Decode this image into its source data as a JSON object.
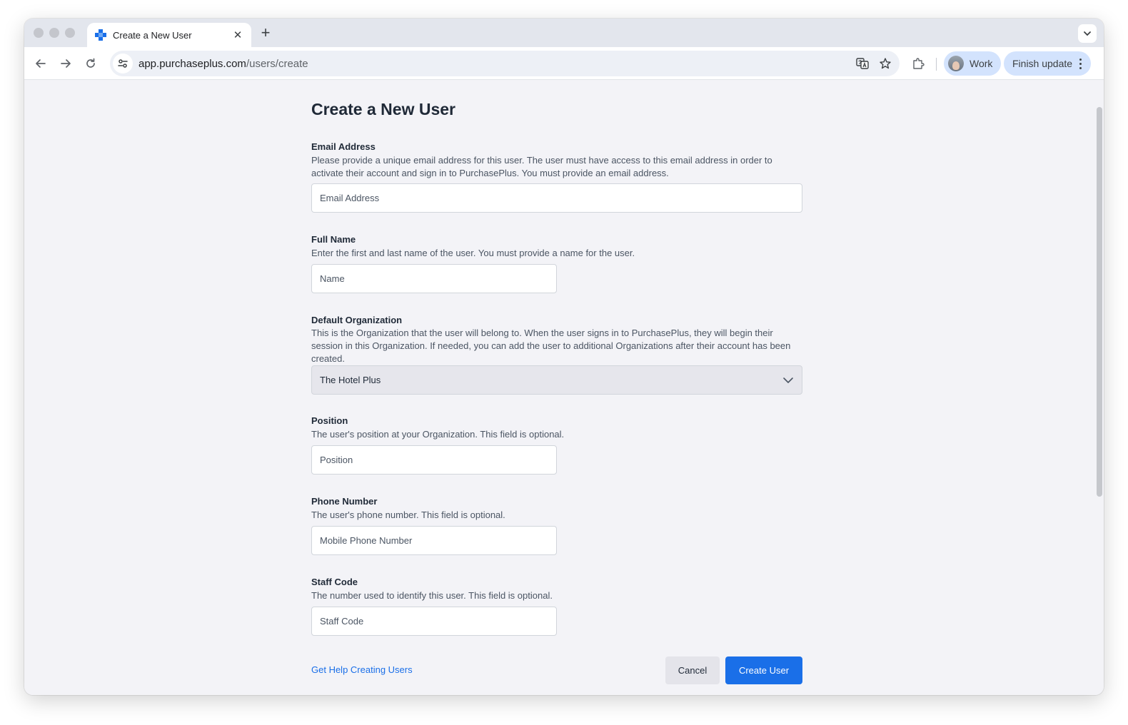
{
  "browser": {
    "tab_title": "Create a New User",
    "url_host": "app.purchaseplus.com",
    "url_path": "/users/create",
    "profile_label": "Work",
    "update_label": "Finish update"
  },
  "page": {
    "title": "Create a New User"
  },
  "fields": {
    "email": {
      "label": "Email Address",
      "description": "Please provide a unique email address for this user. The user must have access to this email address in order to activate their account and sign in to PurchasePlus. You must provide an email address.",
      "placeholder": "Email Address",
      "value": ""
    },
    "full_name": {
      "label": "Full Name",
      "description": "Enter the first and last name of the user. You must provide a name for the user.",
      "placeholder": "Name",
      "value": ""
    },
    "organization": {
      "label": "Default Organization",
      "description": "This is the Organization that the user will belong to. When the user signs in to PurchasePlus, they will begin their session in this Organization. If needed, you can add the user to additional Organizations after their account has been created.",
      "selected": "The Hotel Plus"
    },
    "position": {
      "label": "Position",
      "description": "The user's position at your Organization. This field is optional.",
      "placeholder": "Position",
      "value": ""
    },
    "phone": {
      "label": "Phone Number",
      "description": "The user's phone number. This field is optional.",
      "placeholder": "Mobile Phone Number",
      "value": ""
    },
    "staff_code": {
      "label": "Staff Code",
      "description": "The number used to identify this user. This field is optional.",
      "placeholder": "Staff Code",
      "value": ""
    }
  },
  "footer": {
    "help_link": "Get Help Creating Users",
    "cancel_label": "Cancel",
    "create_label": "Create User"
  },
  "colors": {
    "primary": "#1a6fe8",
    "page_background": "#f3f3f7",
    "text": "#1f2937"
  }
}
